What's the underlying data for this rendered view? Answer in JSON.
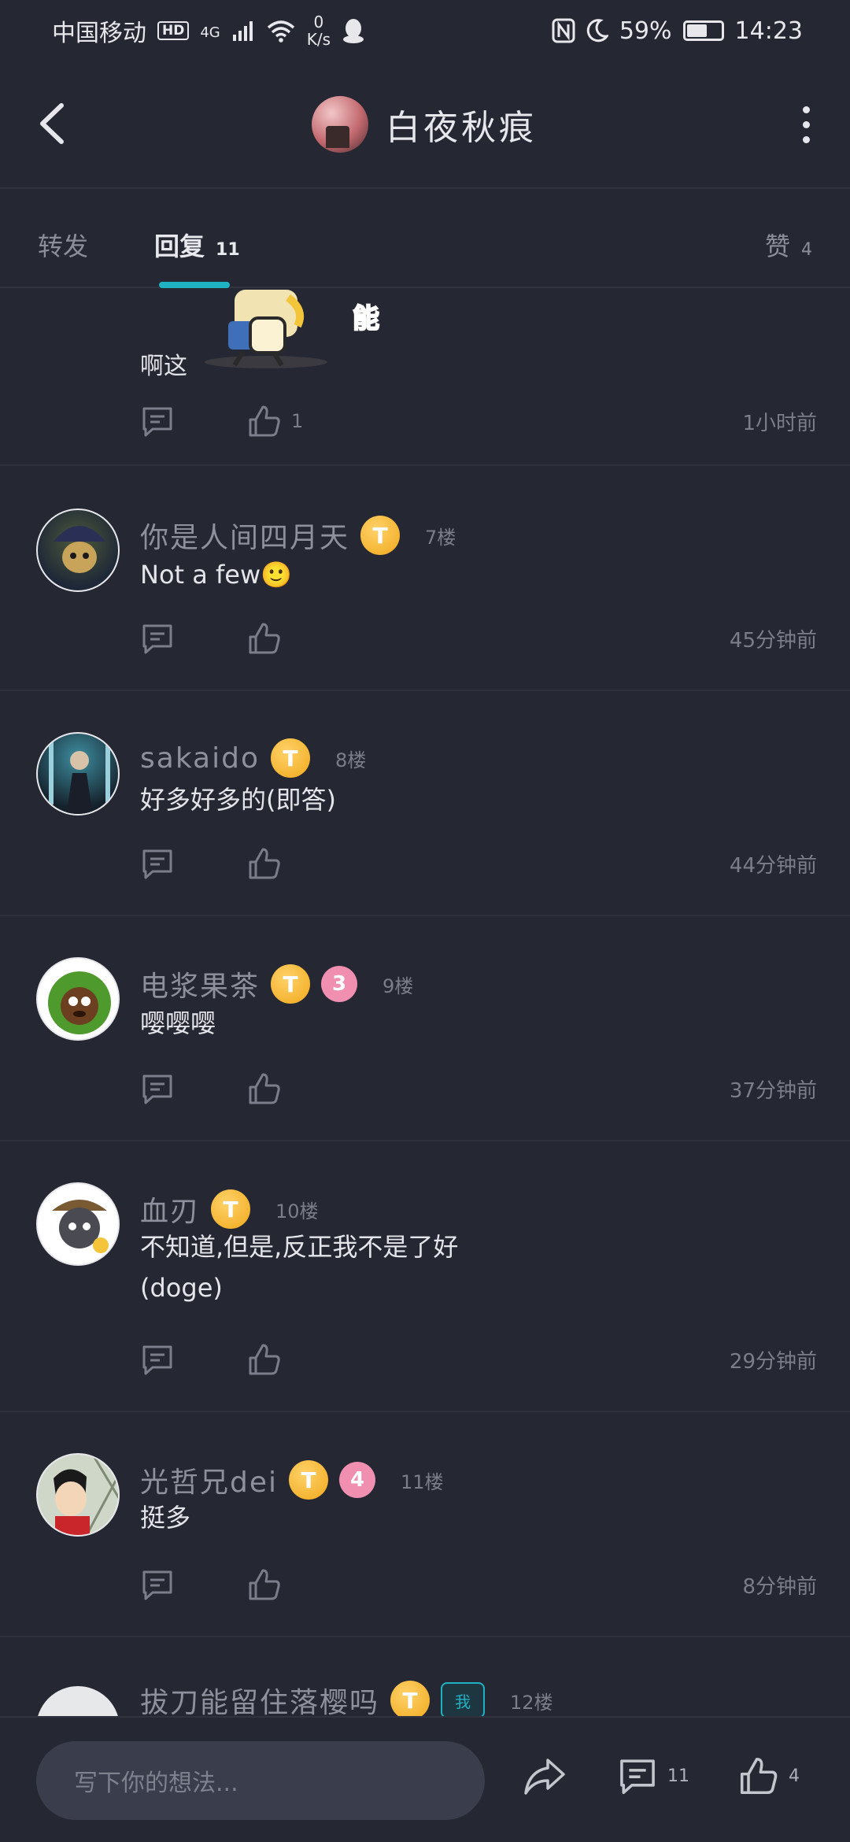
{
  "status_bar": {
    "carrier": "中国移动",
    "hd": "HD",
    "network": "4G",
    "speed_value": "0",
    "speed_unit": "K/s",
    "battery": "59%",
    "battery_level": 0.59,
    "time": "14:23"
  },
  "header": {
    "title": "白夜秋痕"
  },
  "tabs": {
    "repost": {
      "label": "转发"
    },
    "reply": {
      "label": "回复",
      "count": "11"
    },
    "like": {
      "label": "赞",
      "count": "4"
    }
  },
  "top_partial": {
    "text": "啊这",
    "like_count": "1",
    "time": "1小时前"
  },
  "comments": [
    {
      "name": "你是人间四月天",
      "badge": "T",
      "floor": "7楼",
      "text": "Not a few🙂",
      "time": "45分钟前"
    },
    {
      "name": "sakaido",
      "badge": "T",
      "floor": "8楼",
      "text": "好多好多的(即答)",
      "time": "44分钟前"
    },
    {
      "name": "电浆果茶",
      "badge": "T",
      "level": "3",
      "floor": "9楼",
      "text": "嘤嘤嘤",
      "time": "37分钟前"
    },
    {
      "name": "血刃",
      "badge": "T",
      "floor": "10楼",
      "text": "不知道,但是,反正我不是了好",
      "text2": "(doge)",
      "time": "29分钟前"
    },
    {
      "name": "光哲兄dei",
      "badge": "T",
      "level": "4",
      "floor": "11楼",
      "text": "挺多",
      "time": "8分钟前"
    },
    {
      "name": "拔刀能留住落樱吗",
      "badge": "T",
      "me": "我",
      "floor": "12楼"
    }
  ],
  "bottom_bar": {
    "placeholder": "写下你的想法...",
    "comment_count": "11",
    "like_count": "4"
  }
}
